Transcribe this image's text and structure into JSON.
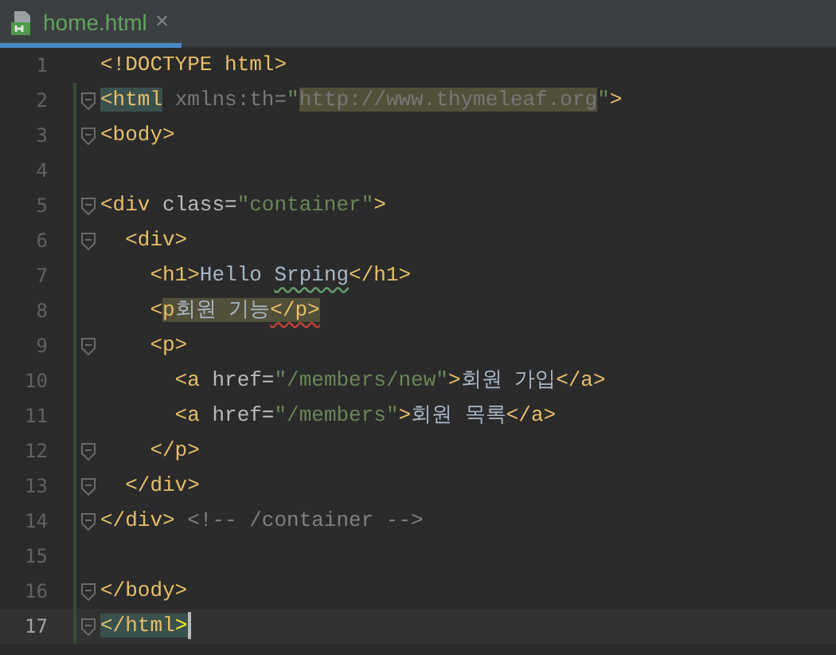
{
  "tabs": [
    {
      "label": "home.html",
      "selected": true,
      "close": "×"
    }
  ],
  "lines": [
    {
      "number": "1",
      "fold": false,
      "current": false,
      "tokens": [
        {
          "kind": "tag",
          "text": "<!DOCTYPE html>"
        }
      ]
    },
    {
      "number": "2",
      "fold": true,
      "current": false,
      "tokens": [
        {
          "kind": "tag",
          "text": "<html",
          "matched": true
        },
        {
          "kind": "unused",
          "text": " xmlns:th="
        },
        {
          "kind": "value",
          "text": "\""
        },
        {
          "kind": "unused",
          "text": "http://www.thymeleaf.org",
          "flagged": true
        },
        {
          "kind": "value",
          "text": "\""
        },
        {
          "kind": "tag",
          "text": ">"
        }
      ]
    },
    {
      "number": "3",
      "fold": true,
      "current": false,
      "tokens": [
        {
          "kind": "tag",
          "text": "<body>"
        }
      ]
    },
    {
      "number": "4",
      "fold": false,
      "current": false
    },
    {
      "number": "5",
      "fold": true,
      "current": false,
      "tokens": [
        {
          "kind": "tag",
          "text": "<div "
        },
        {
          "kind": "attr",
          "text": "class="
        },
        {
          "kind": "value",
          "text": "\"container\""
        },
        {
          "kind": "tag",
          "text": ">"
        }
      ]
    },
    {
      "number": "6",
      "fold": true,
      "current": false,
      "tokens": [
        {
          "kind": "tag",
          "text": "  <div>"
        }
      ]
    },
    {
      "number": "7",
      "fold": false,
      "current": false,
      "tokens": [
        {
          "kind": "tag",
          "text": "    <h1>"
        },
        {
          "kind": "text",
          "text": "Hello "
        },
        {
          "kind": "text",
          "text": "Srping",
          "misspelled": true
        },
        {
          "kind": "tag",
          "text": "</h1>"
        }
      ]
    },
    {
      "number": "8",
      "fold": false,
      "current": false,
      "tokens": [
        {
          "kind": "tag",
          "text": "    <"
        },
        {
          "kind": "tag",
          "text": "p",
          "flagged": true
        },
        {
          "kind": "text",
          "text": "회원 기능",
          "flagged": true
        },
        {
          "kind": "tag",
          "text": "</p>",
          "flagged": true,
          "error": true
        }
      ]
    },
    {
      "number": "9",
      "fold": true,
      "current": false,
      "tokens": [
        {
          "kind": "tag",
          "text": "    <p>"
        }
      ]
    },
    {
      "number": "10",
      "fold": false,
      "current": false,
      "tokens": [
        {
          "kind": "tag",
          "text": "      <a "
        },
        {
          "kind": "attr",
          "text": "href="
        },
        {
          "kind": "value",
          "text": "\"/members/new\""
        },
        {
          "kind": "tag",
          "text": ">"
        },
        {
          "kind": "text",
          "text": "회원 가입"
        },
        {
          "kind": "tag",
          "text": "</a>"
        }
      ]
    },
    {
      "number": "11",
      "fold": false,
      "current": false,
      "tokens": [
        {
          "kind": "tag",
          "text": "      <a "
        },
        {
          "kind": "attr",
          "text": "href="
        },
        {
          "kind": "value",
          "text": "\"/members\""
        },
        {
          "kind": "tag",
          "text": ">"
        },
        {
          "kind": "text",
          "text": "회원 목록"
        },
        {
          "kind": "tag",
          "text": "</a>"
        }
      ]
    },
    {
      "number": "12",
      "fold": true,
      "current": false,
      "tokens": [
        {
          "kind": "tag",
          "text": "    </p>"
        }
      ]
    },
    {
      "number": "13",
      "fold": true,
      "current": false,
      "tokens": [
        {
          "kind": "tag",
          "text": "  </div>"
        }
      ]
    },
    {
      "number": "14",
      "fold": true,
      "current": false,
      "tokens": [
        {
          "kind": "tag",
          "text": "</div>"
        },
        {
          "kind": "comment",
          "text": " <!-- /container -->"
        }
      ]
    },
    {
      "number": "15",
      "fold": false,
      "current": false
    },
    {
      "number": "16",
      "fold": true,
      "current": false,
      "tokens": [
        {
          "kind": "tag",
          "text": "</body>"
        }
      ]
    },
    {
      "number": "17",
      "fold": true,
      "current": true,
      "tokens": [
        {
          "kind": "tag",
          "text": "</html",
          "matched": true
        },
        {
          "kind": "tag",
          "text": ">",
          "matched": true,
          "bright": true
        }
      ]
    }
  ]
}
